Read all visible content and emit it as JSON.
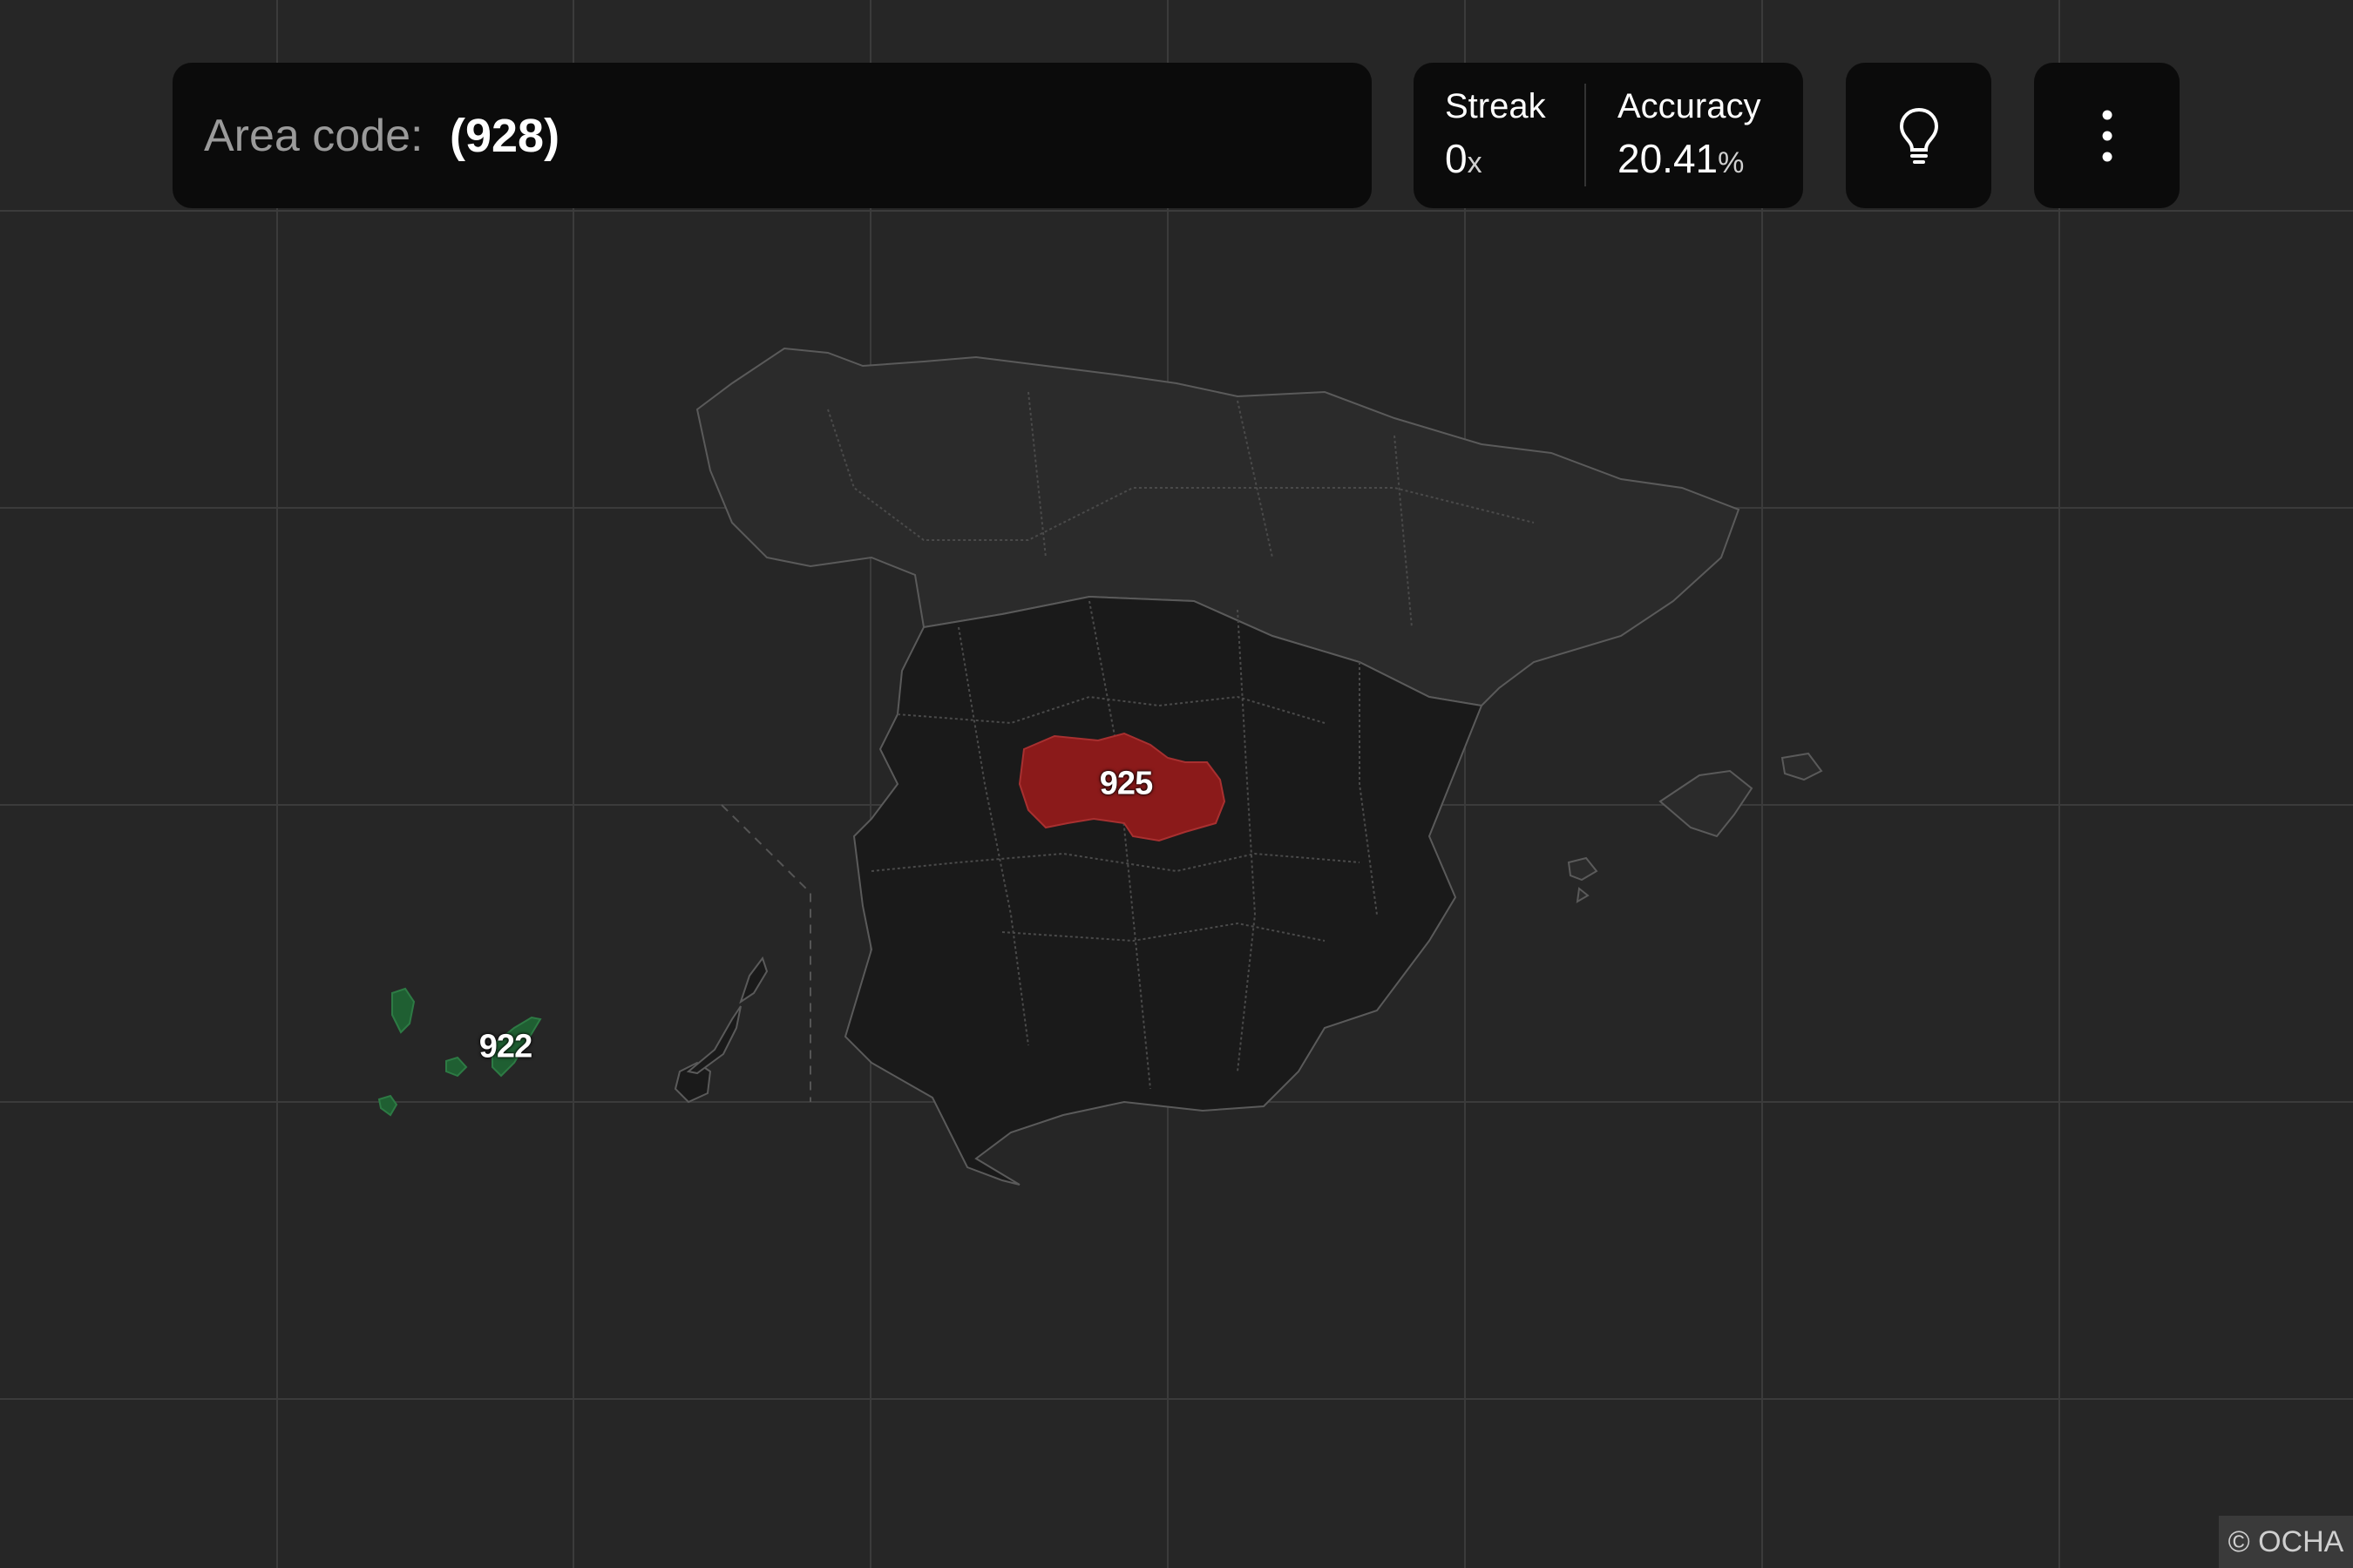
{
  "prompt": {
    "label": "Area code:",
    "value": "(928)"
  },
  "stats": {
    "streak": {
      "label": "Streak",
      "value": "0",
      "unit": "x"
    },
    "accuracy": {
      "label": "Accuracy",
      "value": "20.41",
      "unit": "%"
    }
  },
  "buttons": {
    "hint_icon": "lightbulb-icon",
    "menu_icon": "more-vertical-icon"
  },
  "map": {
    "regions": [
      {
        "code": "925",
        "status": "wrong",
        "color": "#8b1a1a"
      },
      {
        "code": "922",
        "status": "correct",
        "color": "#1f5f32"
      }
    ],
    "colors": {
      "background": "#262626",
      "grid": "#3b3b3b",
      "land_default": "#2b2b2b",
      "land_candidate": "#1a1a1a",
      "border": "#5a5a5a"
    }
  },
  "attribution": "© OCHA"
}
